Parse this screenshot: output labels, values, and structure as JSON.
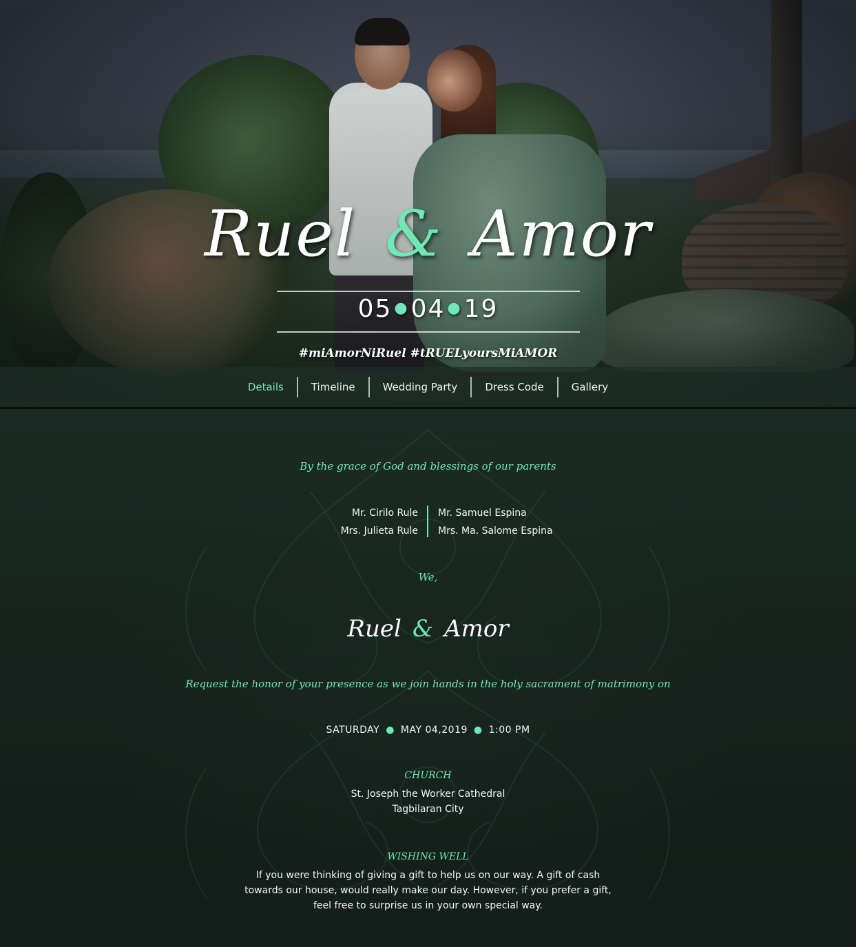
{
  "hero": {
    "groom": "Ruel",
    "amp": "&",
    "bride": "Amor",
    "date": {
      "month": "05",
      "day": "04",
      "year": "19"
    },
    "hashtags": "#miAmorNiRuel #tRUELyoursMiAMOR"
  },
  "nav": {
    "items": [
      "Details",
      "Timeline",
      "Wedding Party",
      "Dress Code",
      "Gallery"
    ],
    "active": "Details"
  },
  "details": {
    "intro": "By the grace of God and blessings of our parents",
    "parents_groom": [
      "Mr. Cirilo Rule",
      "Mrs. Julieta Rule"
    ],
    "parents_bride": [
      "Mr. Samuel Espina",
      "Mrs. Ma. Salome Espina"
    ],
    "we": "We,",
    "groom": "Ruel",
    "amp": "&",
    "bride": "Amor",
    "request": "Request the honor of your presence as we join hands in the holy sacrament of matrimony on",
    "day": "SATURDAY",
    "date": "MAY 04,2019",
    "time": "1:00 PM",
    "church_label": "CHURCH",
    "church_name": "St. Joseph the Worker Cathedral",
    "church_city": "Tagbilaran City",
    "wishing_label": "WISHING WELL",
    "wishing_lines": [
      "If you were thinking of giving a gift to help us on our way. A gift of cash",
      "towards our house, would really make our day. However, if you prefer a gift,",
      "feel free to surprise us in your own special way."
    ]
  },
  "colors": {
    "accent": "#6ee8b4",
    "background": "#17241e",
    "nav_bg": "#1e2e28",
    "text": "#ffffff"
  }
}
